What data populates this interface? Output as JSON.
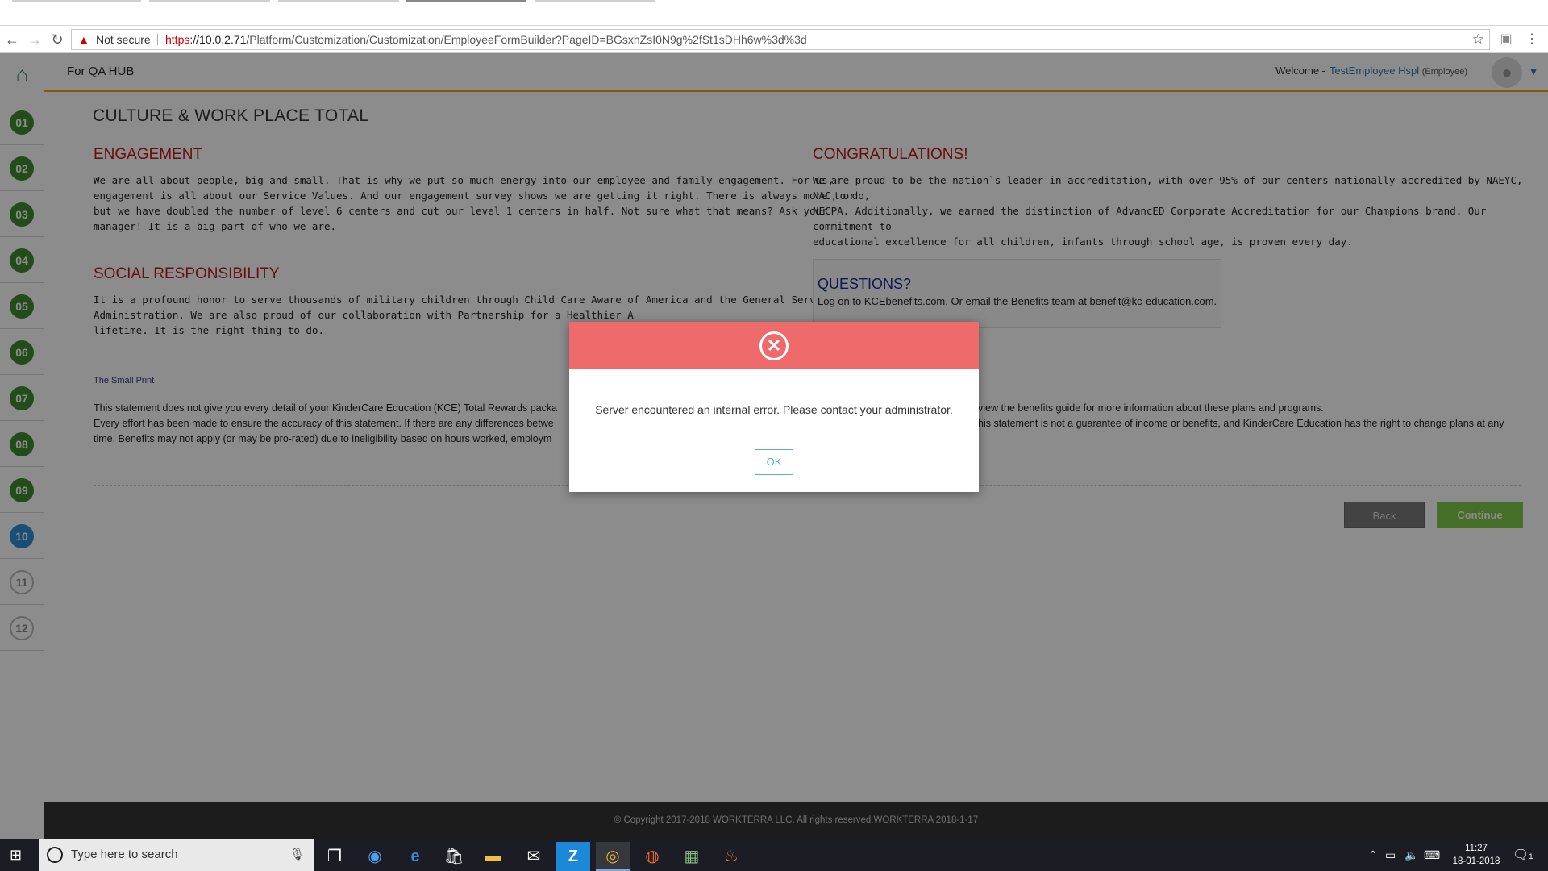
{
  "browser": {
    "not_secure": "Not secure",
    "url_scheme": "https",
    "url_host": "://10.0.2.71",
    "url_path": "/Platform/Customization/Customization/EmployeeFormBuilder?PageID=BGsxhZsI0N9g%2fSt1sDHh6w%3d%3d",
    "icons": {
      "back": "back-arrow-icon",
      "forward": "forward-arrow-icon",
      "reload": "reload-icon",
      "star": "bookmark-star-icon",
      "menu": "kebab-menu-icon"
    }
  },
  "header": {
    "title": "For QA HUB",
    "welcome_label": "Welcome -",
    "user_name": "TestEmployee Hspl",
    "user_role": "(Employee)"
  },
  "sidebar": {
    "steps": [
      {
        "label": "01",
        "state": "done"
      },
      {
        "label": "02",
        "state": "done"
      },
      {
        "label": "03",
        "state": "done"
      },
      {
        "label": "04",
        "state": "done"
      },
      {
        "label": "05",
        "state": "done"
      },
      {
        "label": "06",
        "state": "done"
      },
      {
        "label": "07",
        "state": "done"
      },
      {
        "label": "08",
        "state": "done"
      },
      {
        "label": "09",
        "state": "done"
      },
      {
        "label": "10",
        "state": "current"
      },
      {
        "label": "11",
        "state": "todo"
      },
      {
        "label": "12",
        "state": "todo"
      }
    ]
  },
  "main": {
    "page_title": "CULTURE & WORK PLACE TOTAL",
    "engagement": {
      "heading": "ENGAGEMENT",
      "lines": [
        "We are all about people, big and small. That is why we put so much energy into our employee and family engagement. For us,",
        "engagement is all about our Service Values. And our engagement survey shows we are getting it right. There is always more to do,",
        "but we have doubled the number of level 6 centers and cut our level 1 centers in half. Not sure what that means? Ask your",
        "manager! It is a big part of who we are."
      ]
    },
    "social": {
      "heading": "SOCIAL RESPONSIBILITY",
      "lines": [
        "It is a profound honor to serve thousands of military children through Child Care Aware of America and the General Service",
        "Administration. We are also proud of our collaboration with Partnership for a Healthier A",
        "lifetime. It is the right thing to do."
      ]
    },
    "congrats": {
      "heading": "CONGRATULATIONS!",
      "lines": [
        "We are proud to be the nation`s leader in accreditation, with over 95% of our centers nationally accredited by NAEYC, NAC, or",
        "NECPA. Additionally, we earned the distinction of AdvancED Corporate Accreditation for our Champions brand. Our commitment to",
        "educational excellence for all children, infants through school age, is proven every day."
      ]
    },
    "questions": {
      "heading": "QUESTIONS?",
      "text": "Log on to KCEbenefits.com. Or email the Benefits team at benefit@kc-education.com."
    },
    "small_print": {
      "heading": "The Small Print",
      "left_lines": [
        "This statement does not give you every detail of your KinderCare Education (KCE) Total Rewards packa",
        "Every effort has been made to ensure the accuracy of this statement. If there are any differences betwe",
        "time. Benefits may not apply (or may be pro-rated) due to ineligibility based on hours worked, employm"
      ],
      "right_lines": [
        "view the benefits guide for more information about these plans and programs.",
        "his statement is not a guarantee of income or benefits, and KinderCare Education has the right to change plans at any"
      ]
    },
    "back_label": "Back",
    "continue_label": "Continue"
  },
  "footer": {
    "text": "© Copyright 2017-2018 WORKTERRA LLC. All rights reserved.WORKTERRA 2018-1-17"
  },
  "modal": {
    "message": "Server encountered an internal error. Please contact your administrator.",
    "ok_label": "OK",
    "header_color": "#ef6a6a"
  },
  "taskbar": {
    "search_placeholder": "Type here to search",
    "time": "11:27",
    "date": "18-01-2018",
    "notification_count": "1"
  },
  "colors": {
    "accent_orange": "#f0a020",
    "step_done": "#3f8a2e",
    "step_current": "#2f8ed8",
    "heading_red": "#c01818",
    "continue_green": "#7ec84a"
  }
}
